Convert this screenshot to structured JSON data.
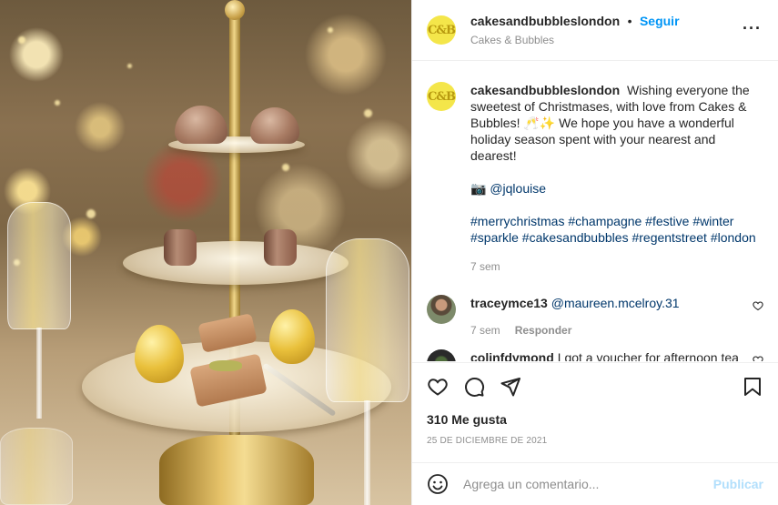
{
  "post": {
    "username": "cakesandbubbleslondon",
    "follow_label": "Seguir",
    "separator": "•",
    "location": "Cakes & Bubbles",
    "avatar_text": "C&B",
    "more_icon": "more-horizontal-icon"
  },
  "caption": {
    "username": "cakesandbubbleslondon",
    "line1": "Wishing everyone the sweetest of Christmases, with love from Cakes & Bubbles! 🥂✨ We hope you have a wonderful holiday season spent with your nearest and dearest!",
    "camera_emoji": "📷",
    "credit": "@jqlouise",
    "hashtags": "#merrychristmas #champagne #festive #winter #sparkle #cakesandbubbles #regentstreet #london",
    "time": "7 sem"
  },
  "comments": [
    {
      "username": "traceymce13",
      "text": "@maureen.mcelroy.31",
      "time": "7 sem",
      "reply_label": "Responder"
    },
    {
      "username": "colinfdymond",
      "text": "I got a voucher for afternoon tea"
    }
  ],
  "actions": {
    "likes": "310 Me gusta",
    "date": "25 DE DICIEMBRE DE 2021"
  },
  "add_comment": {
    "placeholder": "Agrega un comentario...",
    "publish_label": "Publicar"
  },
  "colors": {
    "accent": "#0095f6",
    "link": "#00376b",
    "muted": "#8e8e8e",
    "publish_disabled": "#b2dffc",
    "avatar_bg": "#f4e64a"
  }
}
